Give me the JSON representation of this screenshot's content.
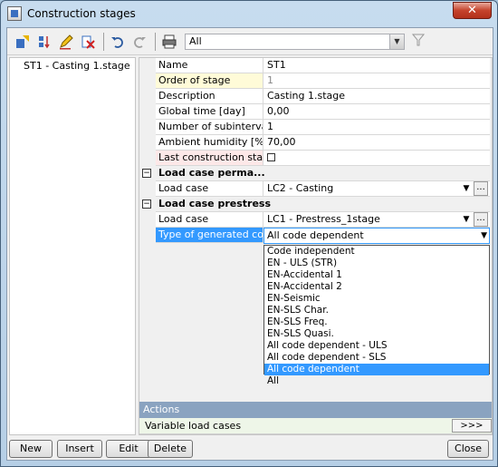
{
  "window": {
    "title": "Construction stages",
    "close_glyph": "✕"
  },
  "toolbar": {
    "icons": [
      "insert-icon",
      "sort-icon",
      "edit-icon",
      "delete-icon",
      "undo-icon",
      "redo-icon",
      "print-icon"
    ],
    "filter": {
      "value": "All"
    }
  },
  "stages": [
    "ST1 - Casting 1.stage"
  ],
  "properties": {
    "name": {
      "label": "Name",
      "value": "ST1"
    },
    "order": {
      "label": "Order of stage",
      "value": "1"
    },
    "description": {
      "label": "Description",
      "value": "Casting 1.stage"
    },
    "global_time": {
      "label": "Global time [day]",
      "value": "0,00"
    },
    "subintervals": {
      "label": "Number of subintervals",
      "value": "1"
    },
    "humidity": {
      "label": "Ambient humidity [%]",
      "value": "70,00"
    },
    "last_stage": {
      "label": "Last construction stage",
      "checked": false
    },
    "group_perm": {
      "label": "Load case perma...",
      "toggle": "−"
    },
    "lc_perm": {
      "label": "Load case",
      "value": "LC2 - Casting",
      "dots": "..."
    },
    "group_prestress": {
      "label": "Load case prestress",
      "toggle": "−"
    },
    "lc_prestress": {
      "label": "Load case",
      "value": "LC1 - Prestress_1stage",
      "dots": "..."
    },
    "type_generated": {
      "label": "Type of generated co...",
      "value": "All code dependent"
    }
  },
  "dropdown": {
    "options": [
      "Code independent",
      "EN - ULS (STR)",
      "EN-Accidental 1",
      "EN-Accidental 2",
      "EN-Seismic",
      "EN-SLS Char.",
      "EN-SLS Freq.",
      "EN-SLS Quasi.",
      "All code dependent - ULS",
      "All code dependent - SLS",
      "All code dependent",
      "All"
    ],
    "selected_index": 10
  },
  "actions": {
    "header": "Actions",
    "variable_load_cases": "Variable load cases",
    "expand_label": ">>>"
  },
  "buttons": {
    "new": "New",
    "insert": "Insert",
    "edit": "Edit",
    "delete": "Delete",
    "close": "Close"
  }
}
